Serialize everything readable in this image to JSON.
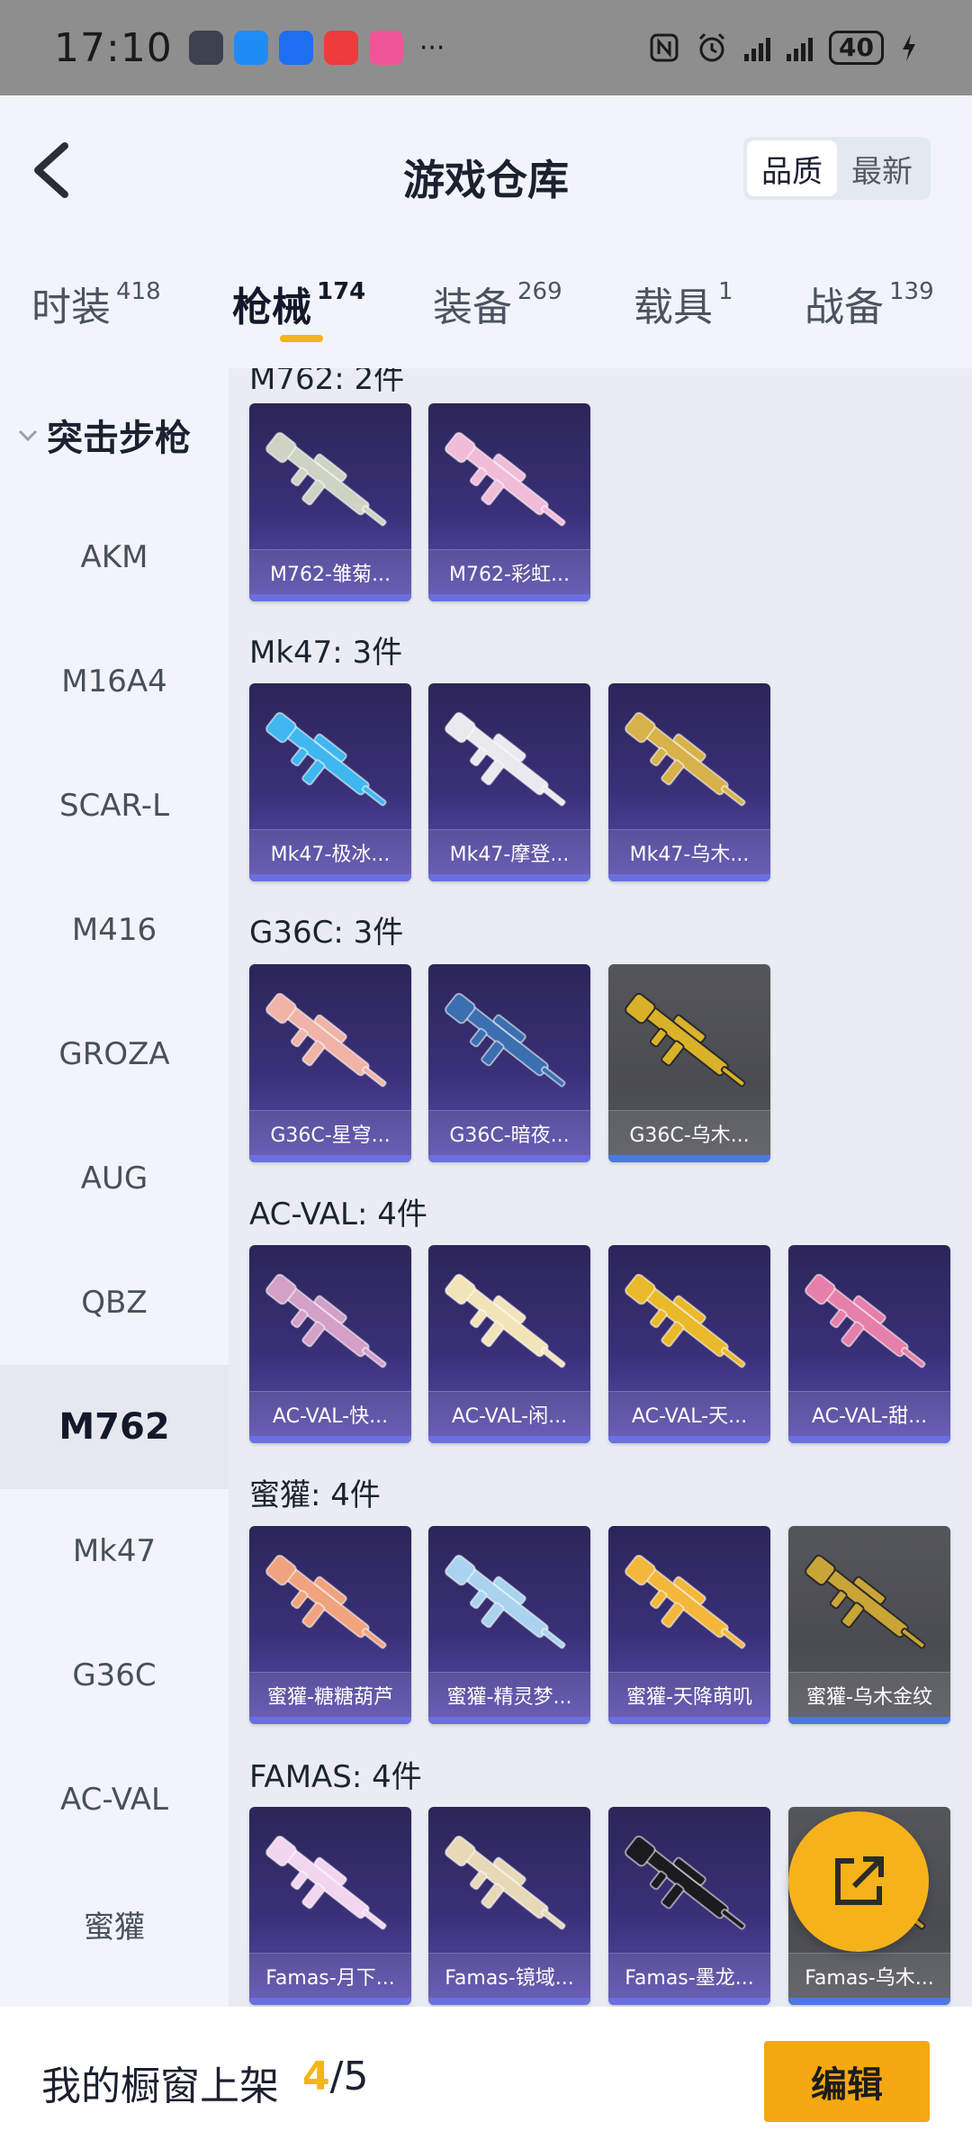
{
  "status_bar": {
    "time": "17:10",
    "battery": "40",
    "more": "···"
  },
  "header": {
    "title": "游戏仓库",
    "sort_options": [
      "品质",
      "最新"
    ],
    "active_sort": "品质"
  },
  "tabs": [
    {
      "label": "时装",
      "count": "418"
    },
    {
      "label": "枪械",
      "count": "174"
    },
    {
      "label": "装备",
      "count": "269"
    },
    {
      "label": "载具",
      "count": "1"
    },
    {
      "label": "战备",
      "count": "139"
    }
  ],
  "active_tab": "枪械",
  "sidebar": {
    "group": "突击步枪",
    "items": [
      "AKM",
      "M16A4",
      "SCAR-L",
      "M416",
      "GROZA",
      "AUG",
      "QBZ",
      "M762",
      "Mk47",
      "G36C",
      "AC-VAL",
      "蜜獾"
    ],
    "active_item": "M762"
  },
  "sections": [
    {
      "title": "M762: 2件",
      "items": [
        {
          "name": "M762-雏菊...",
          "grey": false,
          "color": "#cfd3c4"
        },
        {
          "name": "M762-彩虹...",
          "grey": false,
          "color": "#f0bcd8"
        }
      ]
    },
    {
      "title": "Mk47: 3件",
      "items": [
        {
          "name": "Mk47-极冰...",
          "grey": false,
          "color": "#3fb7f0"
        },
        {
          "name": "Mk47-摩登...",
          "grey": false,
          "color": "#e9e9ee"
        },
        {
          "name": "Mk47-乌木...",
          "grey": false,
          "color": "#d7b24a"
        }
      ]
    },
    {
      "title": "G36C: 3件",
      "items": [
        {
          "name": "G36C-星穹...",
          "grey": false,
          "color": "#f0b3a7"
        },
        {
          "name": "G36C-暗夜...",
          "grey": false,
          "color": "#3b6fb0"
        },
        {
          "name": "G36C-乌木...",
          "grey": true,
          "color": "#d9b22a"
        }
      ]
    },
    {
      "title": "AC-VAL: 4件",
      "items": [
        {
          "name": "AC-VAL-快...",
          "grey": false,
          "color": "#d3a0c7"
        },
        {
          "name": "AC-VAL-闲...",
          "grey": false,
          "color": "#f2e4b9"
        },
        {
          "name": "AC-VAL-天...",
          "grey": false,
          "color": "#eab92a"
        },
        {
          "name": "AC-VAL-甜...",
          "grey": false,
          "color": "#e67fa9"
        }
      ]
    },
    {
      "title": "蜜獾: 4件",
      "items": [
        {
          "name": "蜜獾-糖糖葫芦",
          "grey": false,
          "color": "#f1a37e"
        },
        {
          "name": "蜜獾-精灵梦...",
          "grey": false,
          "color": "#a9d3ee"
        },
        {
          "name": "蜜獾-天降萌叽",
          "grey": false,
          "color": "#f3b73b"
        },
        {
          "name": "蜜獾-乌木金纹",
          "grey": true,
          "color": "#c9a437"
        }
      ]
    },
    {
      "title": "FAMAS: 4件",
      "items": [
        {
          "name": "Famas-月下...",
          "grey": false,
          "color": "#f2d6ef"
        },
        {
          "name": "Famas-镜域...",
          "grey": false,
          "color": "#e7d9b8"
        },
        {
          "name": "Famas-墨龙...",
          "grey": false,
          "color": "#1a1a1f"
        },
        {
          "name": "Famas-乌木...",
          "grey": true,
          "color": "#c9a437"
        }
      ]
    }
  ],
  "bottom_bar": {
    "label": "我的橱窗上架",
    "current": "4",
    "total": "/5",
    "edit_label": "编辑"
  },
  "colors": {
    "accent": "#f5b418",
    "card_purple": "#3a3078",
    "card_grey": "#4b4c52"
  }
}
